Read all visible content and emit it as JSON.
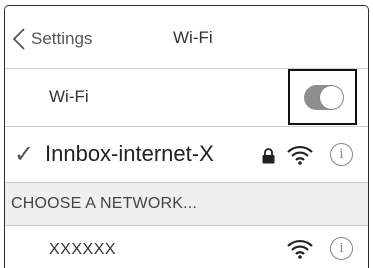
{
  "navbar": {
    "back_label": "Settings",
    "title": "Wi-Fi"
  },
  "wifi_row": {
    "label": "Wi-Fi",
    "toggle_on": true
  },
  "connected_network": {
    "check": "✓",
    "name": "Innbox-internet-X",
    "secured": true,
    "info_symbol": "i"
  },
  "section": {
    "header": "CHOOSE A NETWORK..."
  },
  "networks": [
    {
      "name": "XXXXXX",
      "secured": false,
      "info_symbol": "i"
    }
  ],
  "colors": {
    "toggle_track": "#8e8e8e",
    "section_bg": "#efefef",
    "highlight_border": "#111111"
  }
}
